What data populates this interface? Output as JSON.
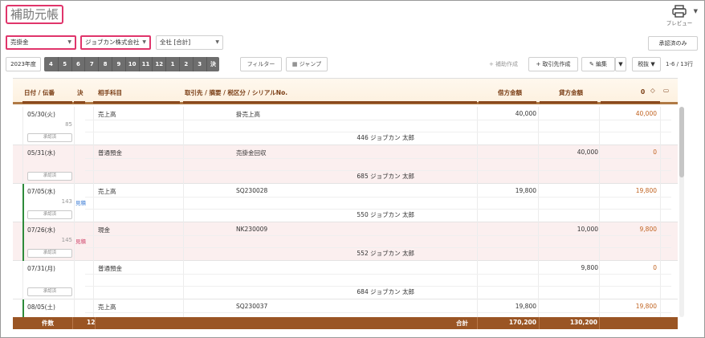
{
  "header": {
    "title": "補助元帳",
    "preview_label": "プレビュー",
    "preview_icon": "printer-icon"
  },
  "filters": {
    "account": "売掛金",
    "partner": "ジョブカン株式会社",
    "company": "全社 [合計]",
    "approved_only": "承認済のみ"
  },
  "toolbar": {
    "year": "2023年度",
    "months": [
      "4",
      "5",
      "6",
      "7",
      "8",
      "9",
      "10",
      "11",
      "12",
      "1",
      "2",
      "3",
      "決"
    ],
    "filter": "フィルター",
    "jump": "ジャンプ",
    "aux_create": "補助作成",
    "partner_create": "取引先作成",
    "edit": "編集",
    "tax": "税抜",
    "row_count": "1-6 / 13行"
  },
  "columns": {
    "date": "日付 / 伝番",
    "settle": "決",
    "account": "相手科目",
    "desc": "取引先 / 摘要 / 税区分 / シリアルNo.",
    "debit": "借方金額",
    "credit": "貸方金額",
    "balance": "0"
  },
  "accent": {
    "highlight": "#e0356b",
    "header_brown": "#8a4a1e",
    "footer": "#9a5524",
    "balance": "#c0621f",
    "bar": "#2e8b3a"
  },
  "entries": [
    {
      "date": "05/30(火)",
      "num": "85",
      "tag": "",
      "approval": "承認済",
      "account": "売上高",
      "desc": "掛売上高",
      "user": "446 ジョブカン 太郎",
      "debit": "40,000",
      "credit": "",
      "balance": "40,000",
      "bar": false,
      "shade": false
    },
    {
      "date": "05/31(水)",
      "num": "",
      "tag": "",
      "approval": "承認済",
      "account": "普通預金",
      "desc": "売掛金回収",
      "user": "685 ジョブカン 太郎",
      "debit": "",
      "credit": "40,000",
      "balance": "0",
      "bar": false,
      "shade": true
    },
    {
      "date": "07/05(水)",
      "num": "143",
      "tag": "見積",
      "approval": "承認済",
      "account": "売上高",
      "desc": "SQ230028",
      "user": "550 ジョブカン 太郎",
      "debit": "19,800",
      "credit": "",
      "balance": "19,800",
      "bar": true,
      "shade": false
    },
    {
      "date": "07/26(水)",
      "num": "145",
      "tag": "見積",
      "approval": "承認済",
      "account": "現金",
      "desc": "NK230009",
      "user": "552 ジョブカン 太郎",
      "debit": "",
      "credit": "10,000",
      "balance": "9,800",
      "bar": true,
      "shade": true
    },
    {
      "date": "07/31(月)",
      "num": "",
      "tag": "",
      "approval": "承認済",
      "account": "普通預金",
      "desc": "",
      "user": "684 ジョブカン 太郎",
      "debit": "",
      "credit": "9,800",
      "balance": "0",
      "bar": false,
      "shade": false
    },
    {
      "date": "08/05(土)",
      "num": "",
      "tag": "",
      "approval": "",
      "account": "売上高",
      "desc": "SQ230037",
      "user": "",
      "debit": "19,800",
      "credit": "",
      "balance": "19,800",
      "bar": true,
      "shade": false
    }
  ],
  "footer": {
    "count_label": "件数",
    "count": "12",
    "total_label": "合計",
    "debit_total": "170,200",
    "credit_total": "130,200"
  }
}
